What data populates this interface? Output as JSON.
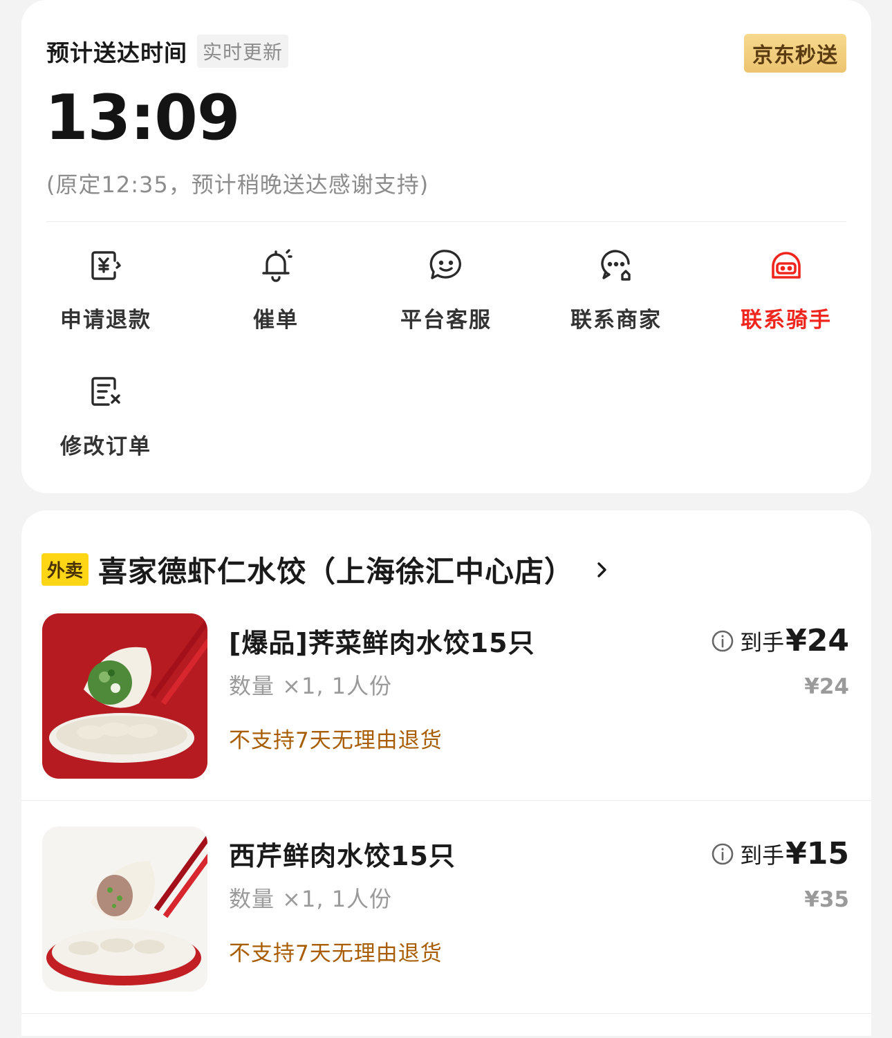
{
  "delivery": {
    "eta_label": "预计送达时间",
    "realtime_tag": "实时更新",
    "brand_tag": "京东秒送",
    "eta_time": "13:09",
    "eta_note": "(原定12:35，预计稍晚送达感谢支持)"
  },
  "actions": [
    {
      "label": "申请退款",
      "icon": "refund-icon"
    },
    {
      "label": "催单",
      "icon": "bell-icon"
    },
    {
      "label": "平台客服",
      "icon": "smile-chat-icon"
    },
    {
      "label": "联系商家",
      "icon": "store-chat-icon"
    },
    {
      "label": "联系骑手",
      "icon": "rider-helmet-icon",
      "highlight_color": "#f0261e"
    },
    {
      "label": "修改订单",
      "icon": "edit-order-icon"
    }
  ],
  "order": {
    "type_tag": "外卖",
    "store_name": "喜家德虾仁水饺（上海徐汇中心店）",
    "items": [
      {
        "name": "[爆品]荠菜鲜肉水饺15只",
        "qty": "数量 ×1, 1人份",
        "policy": "不支持7天无理由退货",
        "price_label": "到手",
        "price_final": "¥24",
        "price_orig": "¥24",
        "image": "dumpling-shepherds-purse-photo"
      },
      {
        "name": "西芹鲜肉水饺15只",
        "qty": "数量 ×1, 1人份",
        "policy": "不支持7天无理由退货",
        "price_label": "到手",
        "price_final": "¥15",
        "price_orig": "¥35",
        "image": "dumpling-celery-photo"
      }
    ]
  }
}
